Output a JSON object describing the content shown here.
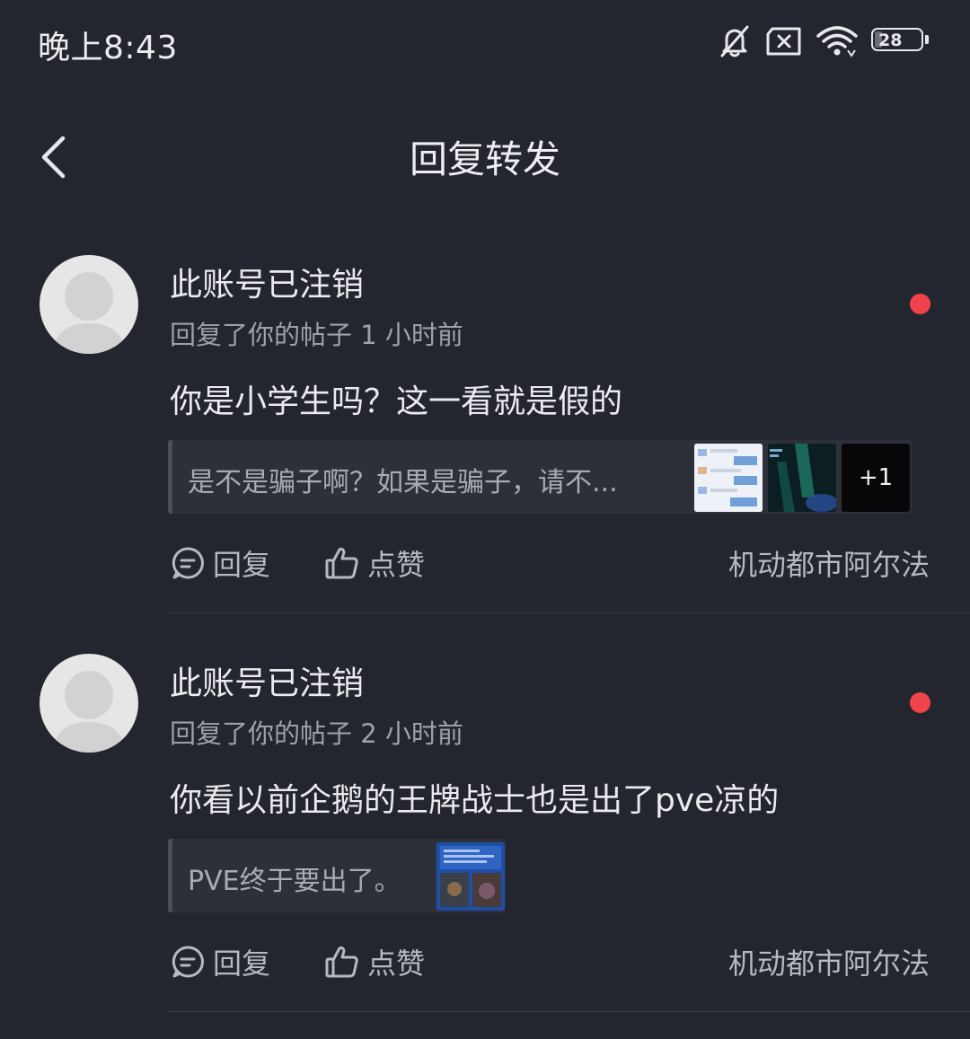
{
  "status_bar": {
    "time": "晚上8:43",
    "battery": "28",
    "icons": [
      "bell-off-icon",
      "sim-x-icon",
      "wifi-icon",
      "battery-icon"
    ]
  },
  "header": {
    "title": "回复转发",
    "back_icon": "chevron-left-icon"
  },
  "colors": {
    "background": "#23252f",
    "unread_dot": "#f0434c",
    "quote_bg": "#2e3039",
    "secondary_text": "#9fa1aa"
  },
  "notifications": [
    {
      "username": "此账号已注销",
      "meta": "回复了你的帖子 1 小时前",
      "content": "你是小学生吗？这一看就是假的",
      "quote_text": "是不是骗子啊？如果是骗子，请不...",
      "more_images": "+1",
      "reply_label": "回复",
      "like_label": "点赞",
      "forum": "机动都市阿尔法"
    },
    {
      "username": "此账号已注销",
      "meta": "回复了你的帖子 2 小时前",
      "content": "你看以前企鹅的王牌战士也是出了pve凉的",
      "quote_text": "PVE终于要出了。",
      "reply_label": "回复",
      "like_label": "点赞",
      "forum": "机动都市阿尔法"
    }
  ]
}
